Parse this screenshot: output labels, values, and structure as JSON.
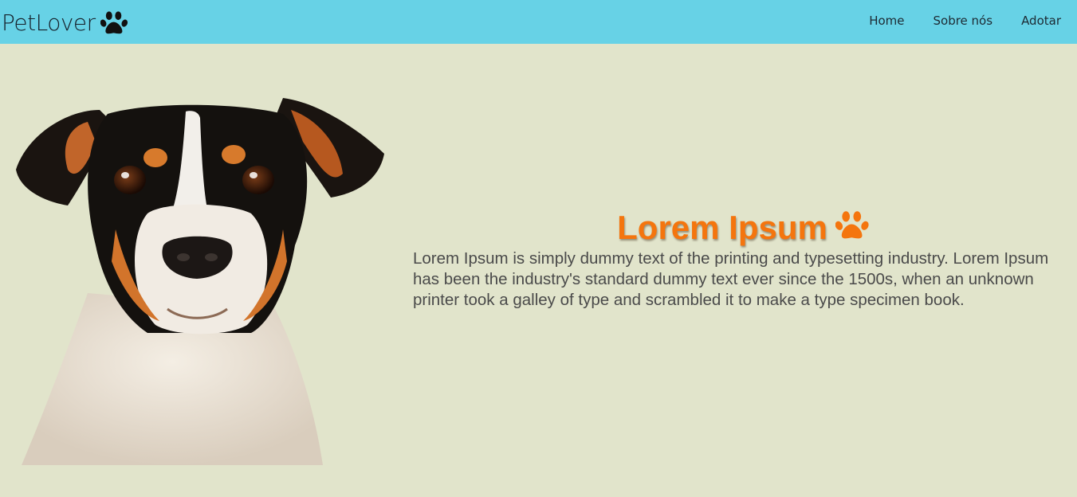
{
  "header": {
    "brand": "PetLover",
    "brand_icon": "paw-icon",
    "nav": [
      {
        "label": "Home"
      },
      {
        "label": "Sobre nós"
      },
      {
        "label": "Adotar"
      }
    ]
  },
  "hero": {
    "image": "dog-photo",
    "title": "Lorem Ipsum",
    "title_icon": "paw-icon",
    "text": "Lorem Ipsum is simply dummy text of the printing and typesetting industry. Lorem Ipsum has been the industry's standard dummy text ever since the 1500s, when an unknown printer took a galley of type and scrambled it to make a type specimen book."
  },
  "colors": {
    "header_bg": "#67d2e6",
    "page_bg": "#e1e4cb",
    "accent": "#f4750e",
    "text": "#4a4a4a"
  }
}
